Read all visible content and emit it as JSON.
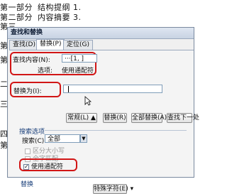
{
  "document": {
    "lines": [
      {
        "prefix": "第一部分",
        "text": "结构提纲 1."
      },
      {
        "prefix": "第二部分",
        "text": "内容摘要 3."
      },
      {
        "prefix": "第三",
        "text": ""
      }
    ],
    "left_chars": [
      "第",
      "第",
      "二",
      "三",
      "四",
      "第"
    ]
  },
  "dialog": {
    "title": "查找和替换",
    "tabs": [
      "查找(D)",
      "替换(P)",
      "定位(G)"
    ],
    "active_tab": 1,
    "find": {
      "label": "查找内容(N):",
      "value": "···[1, ]",
      "options_label": "选项:",
      "options_value": "使用通配符"
    },
    "replace": {
      "label": "替换为(I):",
      "value": ""
    },
    "buttons": {
      "more": "常规(L) ▲",
      "replace": "替换(R)",
      "replace_all": "全部替换(A)",
      "find_next": "查找下一处"
    },
    "search_options": {
      "title": "搜索选项",
      "search_label": "搜索(C):",
      "search_value": "全部",
      "match_case": "区分大小写",
      "whole_word": "全字匹配",
      "use_wildcards": "使用通配符",
      "wildcards_checked": true
    },
    "replace_section": {
      "title": "替换",
      "special_button": "特殊字符(E)"
    }
  },
  "colors": {
    "highlight": "#d11616",
    "titlebar": "#c8d3e3"
  }
}
